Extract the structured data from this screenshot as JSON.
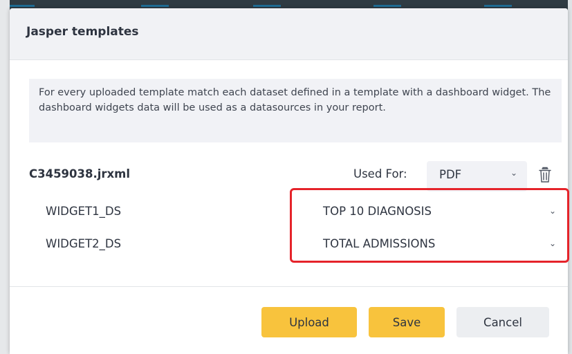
{
  "dialog": {
    "title": "Jasper templates",
    "info_text": "For every uploaded template match each dataset defined in a template with a dashboard widget. The dashboard widgets data will be used as a datasources in your report."
  },
  "template": {
    "file_name": "C3459038.jrxml",
    "used_for_label": "Used For:",
    "used_for_value": "PDF",
    "delete_icon": "trash-icon",
    "datasets": [
      {
        "name": "WIDGET1_DS",
        "widget": "TOP 10 DIAGNOSIS"
      },
      {
        "name": "WIDGET2_DS",
        "widget": "TOTAL ADMISSIONS"
      }
    ]
  },
  "buttons": {
    "upload": "Upload",
    "save": "Save",
    "cancel": "Cancel"
  },
  "colors": {
    "primary_button": "#f8c33d",
    "secondary_button": "#eceef1",
    "highlight": "#e5232a"
  }
}
